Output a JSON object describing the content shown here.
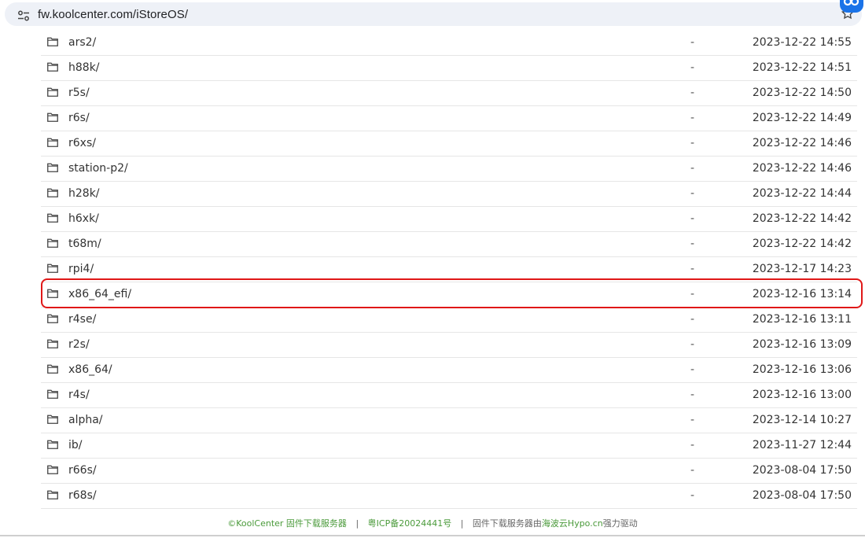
{
  "browser": {
    "url": "fw.koolcenter.com/iStoreOS/"
  },
  "listing": [
    {
      "name": "ars2/",
      "size": "-",
      "date": "2023-12-22 14:55"
    },
    {
      "name": "h88k/",
      "size": "-",
      "date": "2023-12-22 14:51"
    },
    {
      "name": "r5s/",
      "size": "-",
      "date": "2023-12-22 14:50"
    },
    {
      "name": "r6s/",
      "size": "-",
      "date": "2023-12-22 14:49"
    },
    {
      "name": "r6xs/",
      "size": "-",
      "date": "2023-12-22 14:46"
    },
    {
      "name": "station-p2/",
      "size": "-",
      "date": "2023-12-22 14:46"
    },
    {
      "name": "h28k/",
      "size": "-",
      "date": "2023-12-22 14:44"
    },
    {
      "name": "h6xk/",
      "size": "-",
      "date": "2023-12-22 14:42"
    },
    {
      "name": "t68m/",
      "size": "-",
      "date": "2023-12-22 14:42"
    },
    {
      "name": "rpi4/",
      "size": "-",
      "date": "2023-12-17 14:23"
    },
    {
      "name": "x86_64_efi/",
      "size": "-",
      "date": "2023-12-16 13:14"
    },
    {
      "name": "r4se/",
      "size": "-",
      "date": "2023-12-16 13:11"
    },
    {
      "name": "r2s/",
      "size": "-",
      "date": "2023-12-16 13:09"
    },
    {
      "name": "x86_64/",
      "size": "-",
      "date": "2023-12-16 13:06"
    },
    {
      "name": "r4s/",
      "size": "-",
      "date": "2023-12-16 13:00"
    },
    {
      "name": "alpha/",
      "size": "-",
      "date": "2023-12-14 10:27"
    },
    {
      "name": "ib/",
      "size": "-",
      "date": "2023-11-27 12:44"
    },
    {
      "name": "r66s/",
      "size": "-",
      "date": "2023-08-04 17:50"
    },
    {
      "name": "r68s/",
      "size": "-",
      "date": "2023-08-04 17:50"
    }
  ],
  "footer": {
    "part1": "©KoolCenter 固件下载服务器",
    "sep": "|",
    "icp": "粤ICP备20024441号",
    "part3a": "固件下载服务器由",
    "part3b": "海波云Hypo.cn",
    "part3c": "强力驱动"
  },
  "colors": {
    "highlight": "#e01818",
    "footer_link": "#4a9a3a"
  }
}
